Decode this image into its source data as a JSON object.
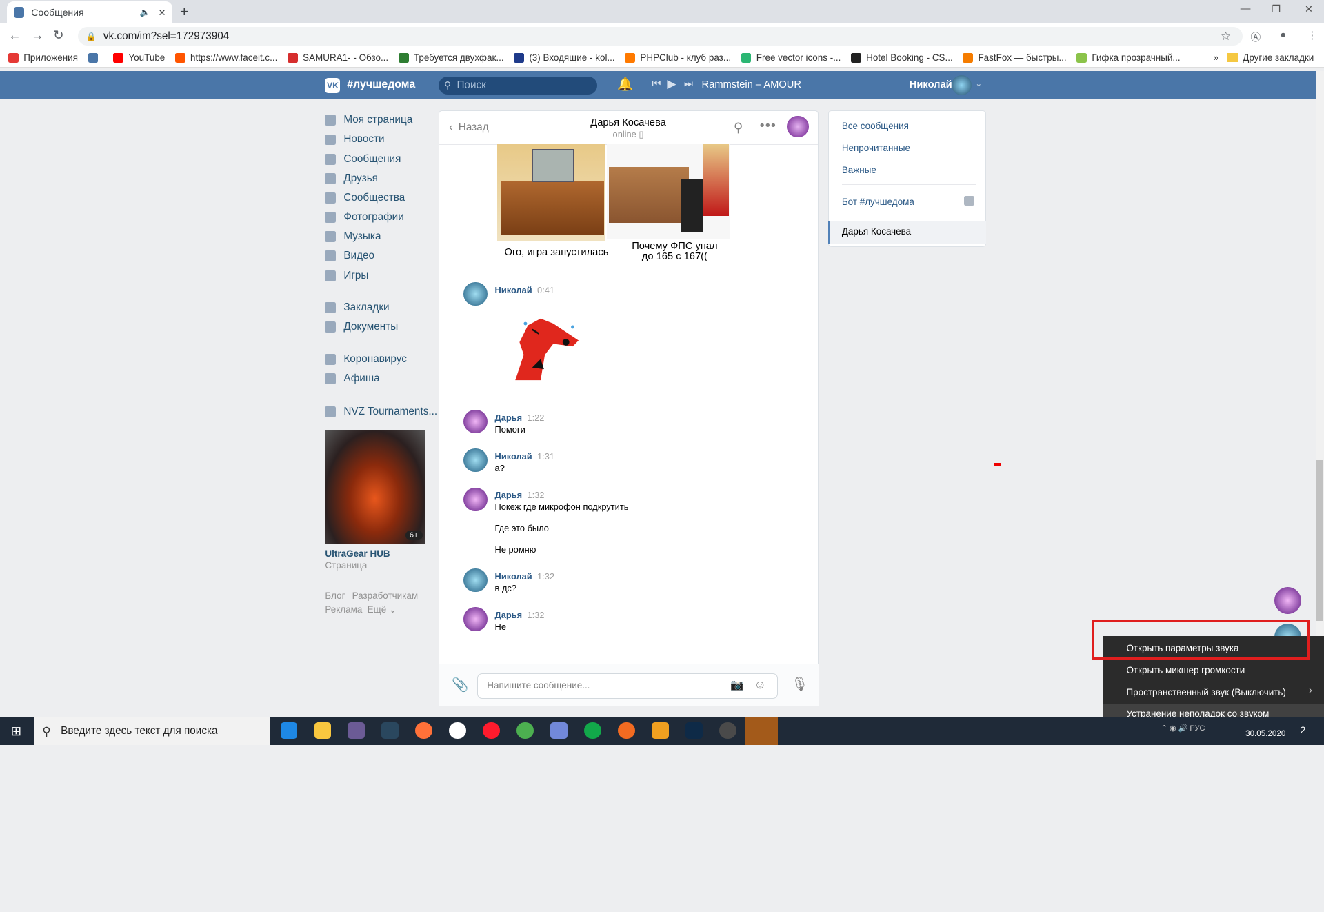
{
  "browser": {
    "tab_title": "Сообщения",
    "url": "vk.com/im?sel=172973904",
    "bookmarks": [
      {
        "label": "Приложения",
        "color": "#e53935"
      },
      {
        "label": "",
        "color": "#4a76a8"
      },
      {
        "label": "YouTube",
        "color": "#ff0000"
      },
      {
        "label": "https://www.faceit.c...",
        "color": "#ff5500"
      },
      {
        "label": "SAMURA1- - Обзо...",
        "color": "#d62e2e"
      },
      {
        "label": "Требуется двухфак...",
        "color": "#2e7d32"
      },
      {
        "label": "(3) Входящие - kol...",
        "color": "#1e3a8a"
      },
      {
        "label": "PHPClub - клуб раз...",
        "color": "#ff7a00"
      },
      {
        "label": "Free vector icons -...",
        "color": "#2bb673"
      },
      {
        "label": "Hotel Booking - CS...",
        "color": "#222222"
      },
      {
        "label": "FastFox — быстры...",
        "color": "#f57c00"
      },
      {
        "label": "Гифка прозрачный...",
        "color": "#8bc34a"
      }
    ],
    "bookmarks_more": "»",
    "other_bookmarks": "Другие закладки"
  },
  "vk": {
    "logo_text": "VK",
    "community": "#лучшедома",
    "search_placeholder": "Поиск",
    "track": "Rammstein – AMOUR",
    "user_name": "Николай",
    "accent": "#4a76a8"
  },
  "menu": {
    "items": [
      {
        "label": "Моя страница",
        "icon": "home-icon"
      },
      {
        "label": "Новости",
        "icon": "news-icon"
      },
      {
        "label": "Сообщения",
        "icon": "messages-icon"
      },
      {
        "label": "Друзья",
        "icon": "friends-icon"
      },
      {
        "label": "Сообщества",
        "icon": "communities-icon"
      },
      {
        "label": "Фотографии",
        "icon": "photos-icon"
      },
      {
        "label": "Музыка",
        "icon": "music-icon"
      },
      {
        "label": "Видео",
        "icon": "video-icon"
      },
      {
        "label": "Игры",
        "icon": "games-icon"
      },
      {
        "label": "Закладки",
        "icon": "bookmarks-icon"
      },
      {
        "label": "Документы",
        "icon": "documents-icon"
      },
      {
        "label": "Коронавирус",
        "icon": "coronavirus-icon"
      },
      {
        "label": "Афиша",
        "icon": "poster-icon"
      },
      {
        "label": "NVZ Tournaments...",
        "icon": "group-icon"
      }
    ],
    "group": {
      "name": "UltraGear HUB",
      "subtitle": "Страница",
      "age": "6+"
    },
    "footer": {
      "blog": "Блог",
      "developers": "Разработчикам",
      "ads": "Реклама",
      "more": "Ещё ⌄"
    }
  },
  "chat": {
    "back": "Назад",
    "name": "Дарья Косачева",
    "status": "online ▯",
    "meme_left": "Ого, игра запустилась",
    "meme_right": "Почему ФПС упал до 165 с 167((",
    "messages": [
      {
        "author": "Николай",
        "time": "0:41",
        "texts": []
      },
      {
        "author": "Дарья",
        "time": "1:22",
        "texts": [
          "Помоги"
        ]
      },
      {
        "author": "Николай",
        "time": "1:31",
        "texts": [
          "а?"
        ]
      },
      {
        "author": "Дарья",
        "time": "1:32",
        "texts": [
          "Покеж где микрофон подкрутить",
          "Где это было",
          "Не ромню"
        ]
      },
      {
        "author": "Николай",
        "time": "1:32",
        "texts": [
          "в дс?"
        ]
      },
      {
        "author": "Дарья",
        "time": "1:32",
        "texts": [
          "Не"
        ]
      }
    ],
    "input_placeholder": "Напишите сообщение..."
  },
  "right_panel": {
    "all": "Все сообщения",
    "unread": "Непрочитанные",
    "important": "Важные",
    "bot": "Бот #лучшедома",
    "selected": "Дарья Косачева"
  },
  "context_menu": {
    "items": [
      "Открыть параметры звука",
      "Открыть микшер громкости",
      "Пространственный звук (Выключить)",
      "Устранение неполадок со звуком"
    ]
  },
  "taskbar": {
    "search_placeholder": "Введите здесь текст для поиска",
    "date": "30.05.2020",
    "notifications": "2",
    "lang": "РУС"
  }
}
